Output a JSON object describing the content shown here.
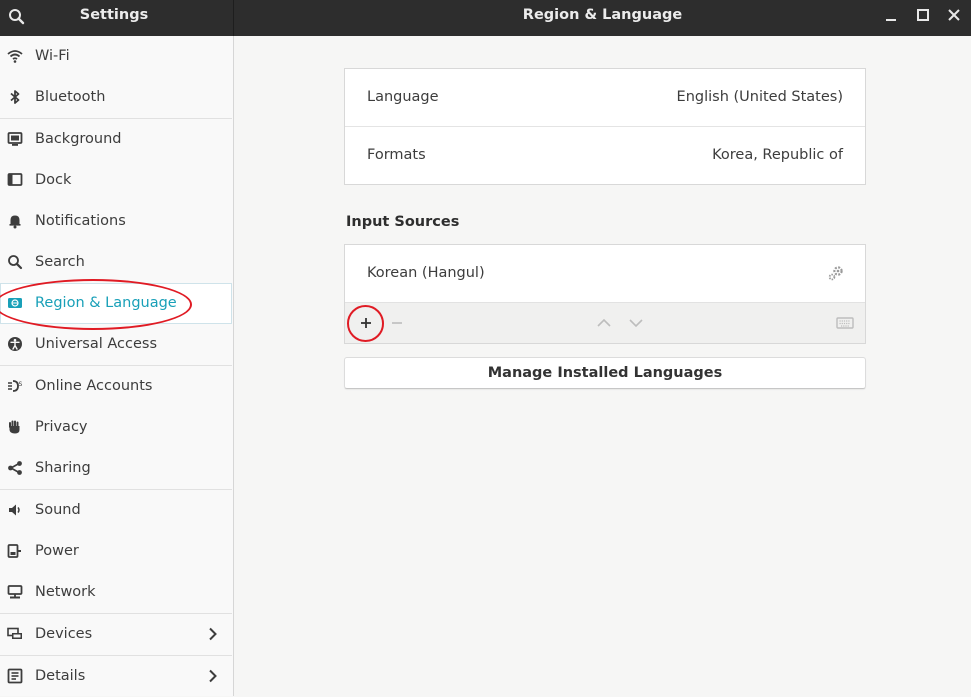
{
  "header": {
    "sidebar_title": "Settings",
    "page_title": "Region & Language"
  },
  "sidebar": {
    "items": [
      {
        "label": "Wi-Fi",
        "icon": "wifi-icon"
      },
      {
        "label": "Bluetooth",
        "icon": "bluetooth-icon"
      },
      {
        "label": "Background",
        "icon": "background-icon"
      },
      {
        "label": "Dock",
        "icon": "dock-icon"
      },
      {
        "label": "Notifications",
        "icon": "bell-icon"
      },
      {
        "label": "Search",
        "icon": "search-icon"
      },
      {
        "label": "Region & Language",
        "icon": "region-language-icon"
      },
      {
        "label": "Universal Access",
        "icon": "universal-access-icon"
      },
      {
        "label": "Online Accounts",
        "icon": "online-accounts-icon"
      },
      {
        "label": "Privacy",
        "icon": "hand-icon"
      },
      {
        "label": "Sharing",
        "icon": "share-icon"
      },
      {
        "label": "Sound",
        "icon": "speaker-icon"
      },
      {
        "label": "Power",
        "icon": "power-icon"
      },
      {
        "label": "Network",
        "icon": "network-icon"
      },
      {
        "label": "Devices",
        "icon": "devices-icon"
      },
      {
        "label": "Details",
        "icon": "details-icon"
      }
    ],
    "active": "Region & Language"
  },
  "region": {
    "language_label": "Language",
    "language_value": "English (United States)",
    "formats_label": "Formats",
    "formats_value": "Korea, Republic of"
  },
  "input_sources": {
    "title": "Input Sources",
    "items": [
      {
        "label": "Korean (Hangul)"
      }
    ]
  },
  "manage_button": "Manage Installed Languages",
  "colors": {
    "accent": "#19a0b8",
    "headerbar": "#2d2d2d",
    "annotation": "#e01b24"
  }
}
